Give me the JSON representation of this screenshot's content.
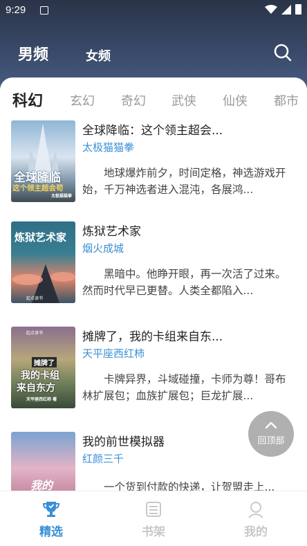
{
  "status_bar": {
    "time": "9:29"
  },
  "top_tabs": {
    "male": "男频",
    "female": "女频"
  },
  "categories": [
    "科幻",
    "玄幻",
    "奇幻",
    "武侠",
    "仙侠",
    "都市"
  ],
  "books": [
    {
      "title": "全球降临：这个领主超会...",
      "author": "太极猫猫拳",
      "description": "地球爆炸前夕，时间定格，神选游戏开始，千万神选者进入混沌，各展鸿...",
      "cover_title": "全球降临",
      "cover_subtitle": "这个领主超会苟",
      "cover_author": "太极猫猫拳"
    },
    {
      "title": "炼狱艺术家",
      "author": "烟火成城",
      "description": "黑暗中。他睁开眼，再一次活了过来。然而时代早已更替。人类全都陷入...",
      "cover_title": "炼狱艺术家",
      "cover_badge": "起点读书"
    },
    {
      "title": "摊牌了，我的卡组来自东...",
      "author": "天平座西红柿",
      "description": "卡牌异界，斗域碰撞，卡师为尊！哥布林扩展包；血族扩展包；巨龙扩展...",
      "cover_title_1": "摊牌了",
      "cover_title_2": "我的卡组",
      "cover_title_3": "来自东方",
      "cover_badge": "起点读书",
      "cover_author": "天平座西红柿 著"
    },
    {
      "title": "我的前世模拟器",
      "author": "红颜三千",
      "description": "一个货到付款的快递，让贺盟走上...",
      "cover_title": "我的"
    }
  ],
  "back_to_top": "回顶部",
  "bottom_nav": [
    {
      "label": "精选",
      "active": true
    },
    {
      "label": "书架",
      "active": false
    },
    {
      "label": "我的",
      "active": false
    }
  ],
  "colors": {
    "accent": "#3a8fd6",
    "inactive": "#c8c8c8",
    "header": "#34405a"
  }
}
